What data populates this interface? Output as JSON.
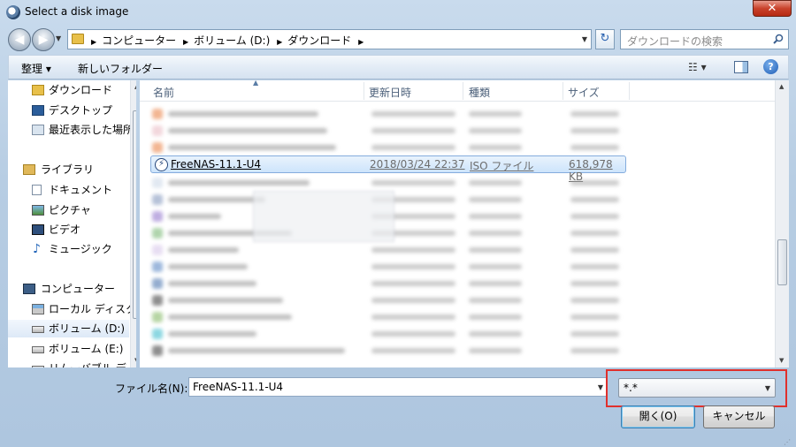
{
  "window": {
    "title": "Select a disk image",
    "close_label": "✕"
  },
  "navbar": {
    "breadcrumbs": [
      "コンピューター",
      "ボリューム (D:)",
      "ダウンロード"
    ],
    "search_placeholder": "ダウンロードの検索"
  },
  "toolbar": {
    "organize_label": "整理 ▾",
    "new_folder_label": "新しいフォルダー",
    "views_label": "☷ ▾",
    "help_label": "?"
  },
  "nav_pane": {
    "items": [
      {
        "label": "ダウンロード",
        "icon": "folder-download-icon",
        "indent": 1
      },
      {
        "label": "デスクトップ",
        "icon": "desktop-icon",
        "indent": 1
      },
      {
        "label": "最近表示した場所",
        "icon": "recent-places-icon",
        "indent": 1
      },
      {
        "label": "ライブラリ",
        "icon": "library-icon",
        "indent": 0
      },
      {
        "label": "ドキュメント",
        "icon": "documents-icon",
        "indent": 1
      },
      {
        "label": "ピクチャ",
        "icon": "pictures-icon",
        "indent": 1
      },
      {
        "label": "ビデオ",
        "icon": "videos-icon",
        "indent": 1
      },
      {
        "label": "ミュージック",
        "icon": "music-icon",
        "indent": 1
      },
      {
        "label": "コンピューター",
        "icon": "computer-icon",
        "indent": 0
      },
      {
        "label": "ローカル ディスク",
        "icon": "local-disk-icon",
        "indent": 1
      },
      {
        "label": "ボリューム (D:)",
        "icon": "drive-icon",
        "indent": 1,
        "selected": true
      },
      {
        "label": "ボリューム (E:)",
        "icon": "drive-icon",
        "indent": 1
      },
      {
        "label": "リムーバブル ディスク",
        "icon": "removable-disk-icon",
        "indent": 1
      }
    ]
  },
  "file_list": {
    "columns": [
      "名前",
      "更新日時",
      "種類",
      "サイズ"
    ],
    "selected_file": {
      "name": "FreeNAS-11.1-U4",
      "modified": "2018/03/24 22:37",
      "type": "ISO ファイル",
      "size": "618,978 KB"
    }
  },
  "bottom": {
    "filename_label": "ファイル名(N):",
    "filename_value": "FreeNAS-11.1-U4",
    "filter_value": "*.*",
    "open_label": "開く(O)",
    "cancel_label": "キャンセル"
  },
  "colors": {
    "highlight_border": "#e0302c",
    "selection_border": "#84acdd"
  }
}
